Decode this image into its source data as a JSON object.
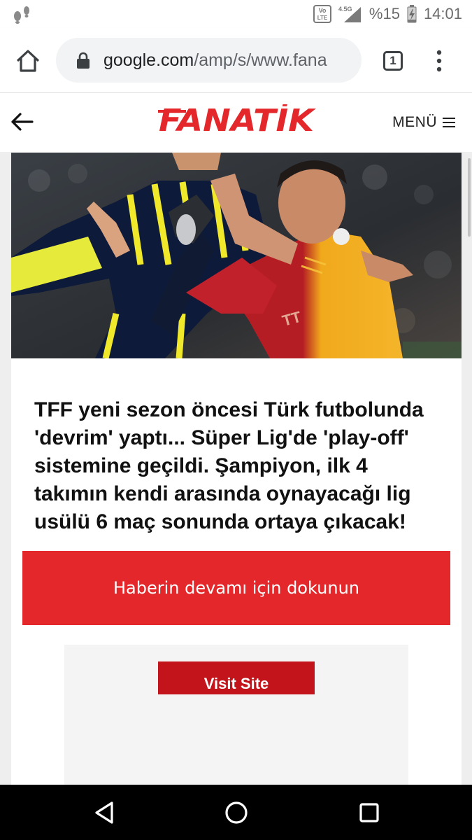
{
  "status_bar": {
    "battery": "%15",
    "time": "14:01",
    "network": "4.5G",
    "volte_line1": "Vo",
    "volte_line2": "LTE"
  },
  "browser": {
    "url_host": "google.com",
    "url_path": "/amp/s/www.fana",
    "tab_count": "1"
  },
  "site_header": {
    "logo": "FANATİK",
    "menu_label": "MENÜ"
  },
  "article": {
    "hero_icon": "football-match-photo",
    "headline": "TFF yeni sezon öncesi Türk futbolunda 'devrim' yaptı... Süper Lig'de 'play-off' sistemine geçildi. Şampiyon, ilk 4 takımın kendi arasında oynayacağı lig usülü 6 maç sonunda ortaya çıkacak!",
    "cta_label": "Haberin devamı için dokunun"
  },
  "ad": {
    "button_label": "Visit Site"
  },
  "colors": {
    "brand_red": "#e4272b",
    "ad_button": "#c4141b"
  }
}
